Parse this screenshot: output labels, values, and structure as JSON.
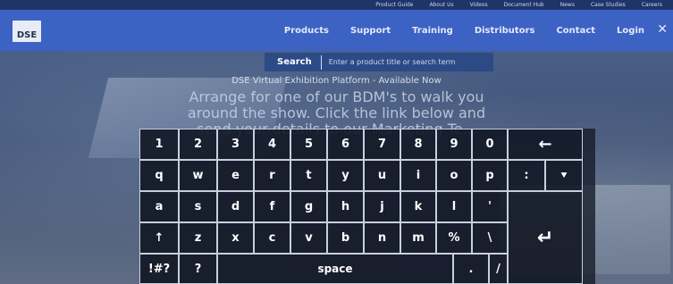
{
  "topbar": {
    "links": [
      "Product Guide",
      "About Us",
      "Videos",
      "Document Hub",
      "News",
      "Case Studies",
      "Careers"
    ]
  },
  "header": {
    "logo_text": "DSE",
    "nav": [
      "Products",
      "Support",
      "Training",
      "Distributors",
      "Contact",
      "Login"
    ],
    "close": "✕"
  },
  "search": {
    "label": "Search",
    "placeholder": "Enter a product title or search term"
  },
  "banner": {
    "title": "DSE Virtual Exhibition Platform - Available Now",
    "lines": [
      "Arrange for one of our BDM's to walk you",
      "around the show. Click the link below and",
      "send your details to our Marketing Te..."
    ]
  },
  "keyboard": {
    "row1": [
      "1",
      "2",
      "3",
      "4",
      "5",
      "6",
      "7",
      "8",
      "9",
      "0",
      "←"
    ],
    "row2": [
      "q",
      "w",
      "e",
      "r",
      "t",
      "y",
      "u",
      "i",
      "o",
      "p",
      ":",
      "⯆"
    ],
    "row3": [
      "a",
      "s",
      "d",
      "f",
      "g",
      "h",
      "j",
      "k",
      "l",
      "'"
    ],
    "row4": [
      "↑",
      "z",
      "x",
      "c",
      "v",
      "b",
      "n",
      "m",
      "%",
      "\\"
    ],
    "row5": [
      "!#?",
      "?",
      "space",
      ".",
      "/"
    ],
    "enter": "↵"
  }
}
